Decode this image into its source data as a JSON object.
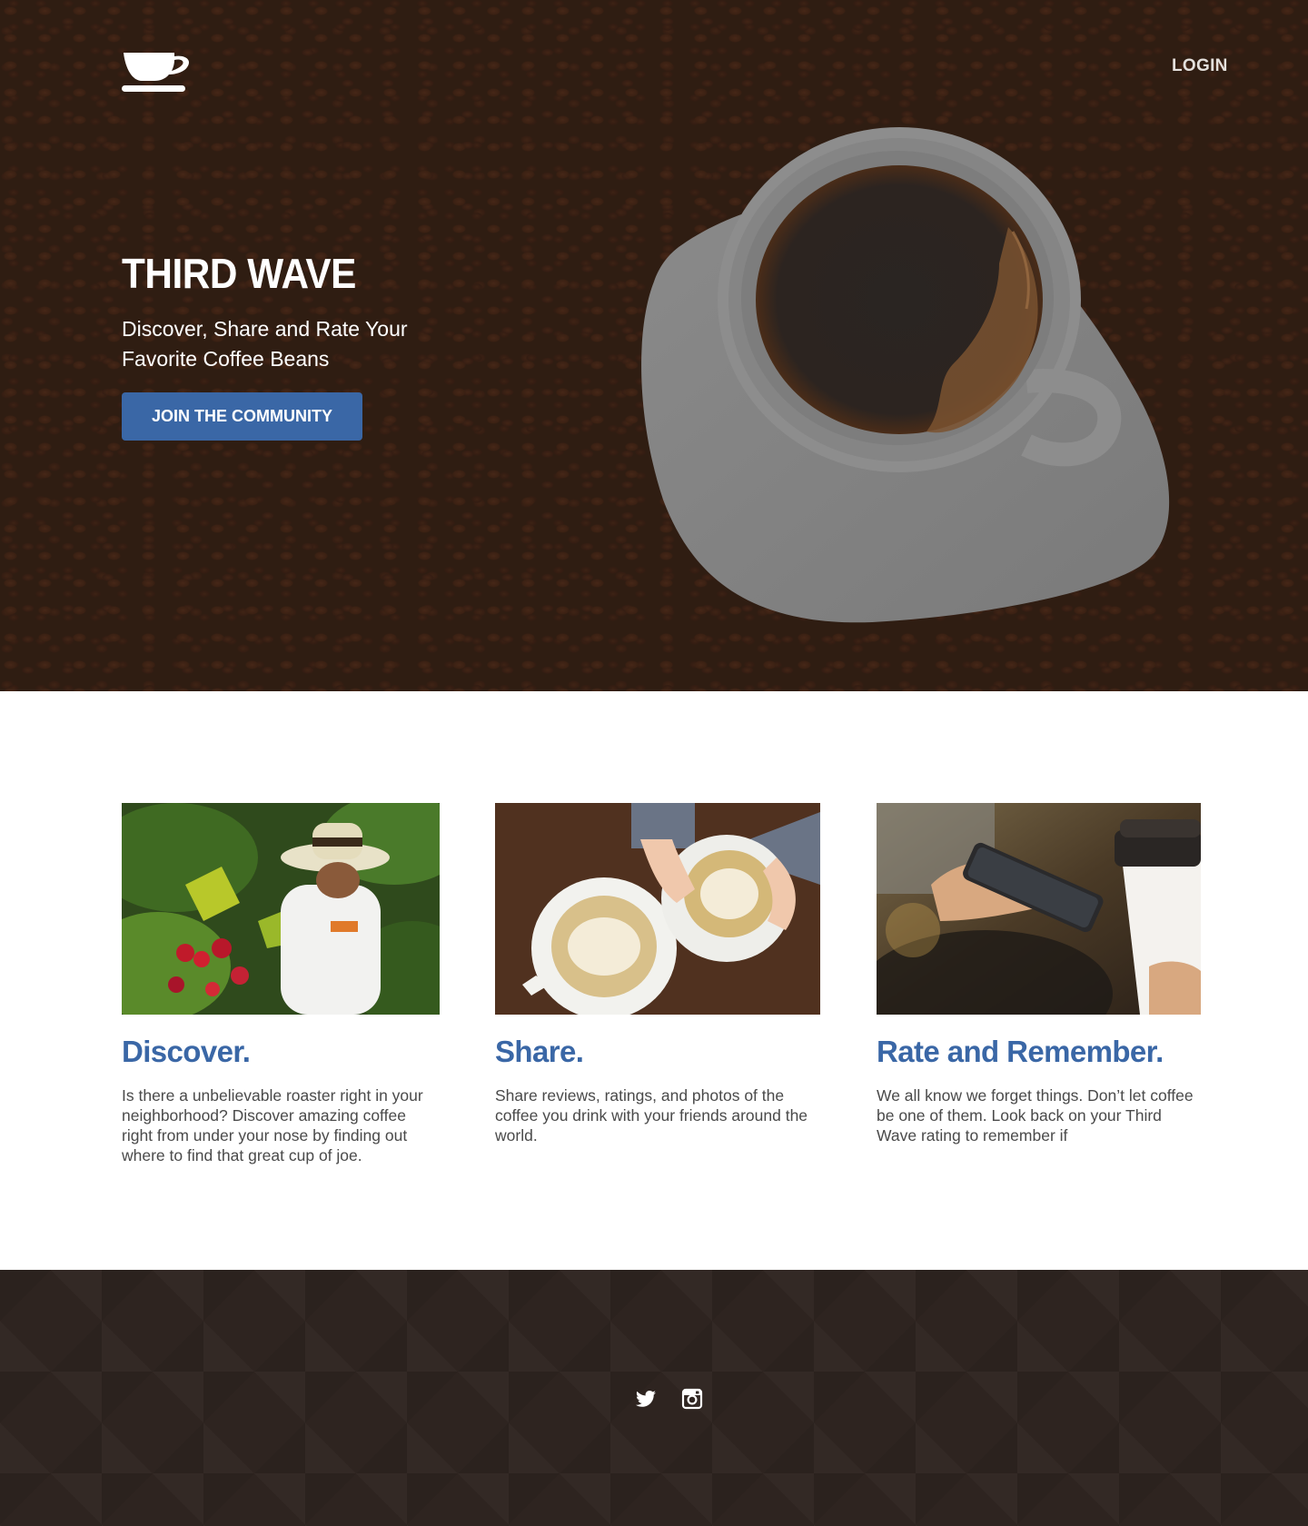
{
  "header": {
    "logo_icon": "coffee-cup-icon",
    "login_label": "LOGIN"
  },
  "hero": {
    "title": "THIRD WAVE",
    "subtitle": "Discover, Share and Rate Your Favorite Coffee Beans",
    "cta_label": "JOIN THE COMMUNITY",
    "accent_color": "#3a67a6"
  },
  "features": [
    {
      "image": "coffee-farmer-photo",
      "title": "Discover.",
      "text": "Is there a unbelievable roaster right in your neighborhood? Discover amazing coffee right from under your nose by finding out where to find that great cup of joe."
    },
    {
      "image": "latte-art-cups-photo",
      "title": "Share.",
      "text": "Share reviews, ratings, and photos of the coffee you drink with your friends around the world."
    },
    {
      "image": "phone-and-coffee-photo",
      "title": "Rate and Remember.",
      "text": "We all know we forget things. Don’t let coffee be one of them. Look back on your Third Wave rating to remember if"
    }
  ],
  "footer": {
    "social_icons": [
      "twitter-icon",
      "instagram-icon"
    ],
    "background_color": "#2e2420"
  }
}
